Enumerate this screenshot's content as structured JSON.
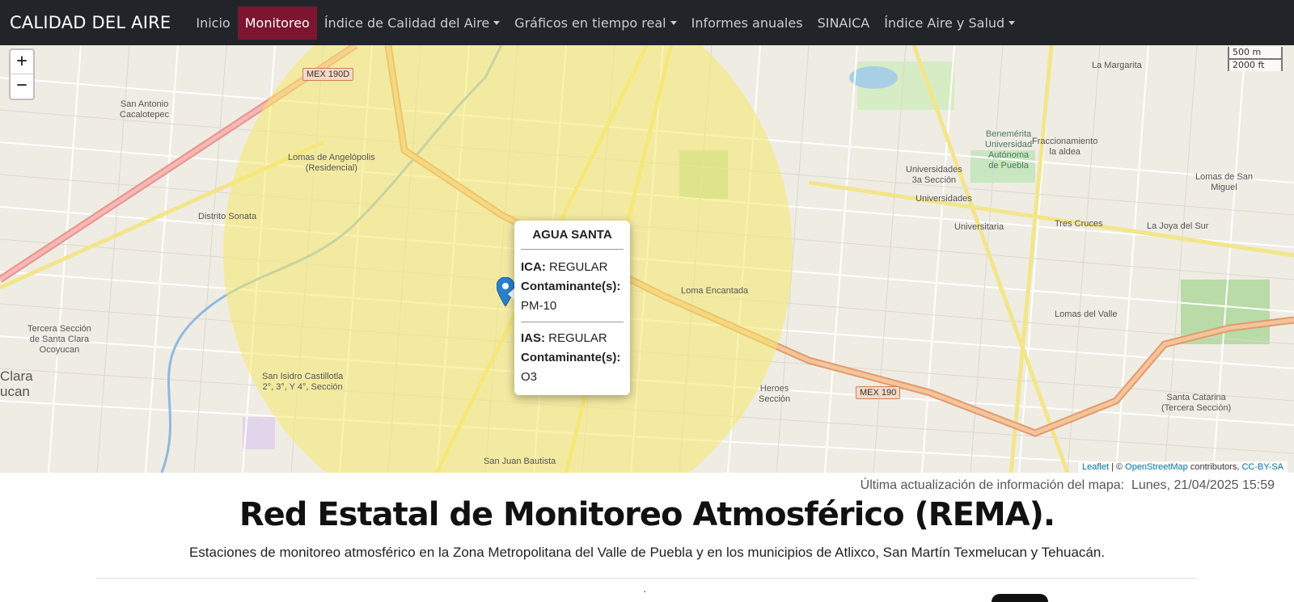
{
  "brand": "CALIDAD DEL AIRE",
  "nav": {
    "items": [
      {
        "label": "Inicio",
        "active": false,
        "dropdown": false
      },
      {
        "label": "Monitoreo",
        "active": true,
        "dropdown": false
      },
      {
        "label": "Índice de Calidad del Aire",
        "active": false,
        "dropdown": true
      },
      {
        "label": "Gráficos en tiempo real",
        "active": false,
        "dropdown": true
      },
      {
        "label": "Informes anuales",
        "active": false,
        "dropdown": false
      },
      {
        "label": "SINAICA",
        "active": false,
        "dropdown": false
      },
      {
        "label": "Índice Aire y Salud",
        "active": false,
        "dropdown": true
      }
    ]
  },
  "map": {
    "zoom_in": "+",
    "zoom_out": "−",
    "scale": {
      "metric": "500 m",
      "imperial": "2000 ft"
    },
    "labels": {
      "san_antonio": "San Antonio\nCacalotepec",
      "lomas_angelopolis": "Lomas de Angelópolis\n(Residencial)",
      "distrito_sonata": "Distrito Sonata",
      "tercera_seccion": "Tercera Sección\nde Santa Clara\nOcoyucan",
      "clara": "Clara\nucan",
      "san_isidro": "San Isidro Castillotla\n2°, 3°, Y 4°, Sección",
      "loma_encantada": "Loma Encantada",
      "universidades_3a": "Universidades\n3a Sección",
      "universidades": "Universidades",
      "universitaria": "Universitaria",
      "tres_cruces": "Tres Cruces",
      "la_joya": "La Joya del Sur",
      "lomas_del_valle": "Lomas del Valle",
      "santa_catarina": "Santa Catarina\n(Tercera Sección)",
      "lomas_san_miguel": "Lomas de San\nMiguel",
      "la_margarita": "La Margarita",
      "buap": "Benemérita\nUniversidad\nAutónoma\nde Puebla",
      "fraccionamiento": "Fraccionamiento\nla aldea",
      "heroes": "Heroes\nSección",
      "san_juan": "San Juan Bautista"
    },
    "shields": {
      "mex190d": "MEX 190D",
      "mex190": "MEX 190"
    },
    "marker_color": "#2a81cb",
    "circle_color": "#f5e96b",
    "popup": {
      "station": "AGUA SANTA",
      "ica_label": "ICA:",
      "ica_value": "REGULAR",
      "ica_pollutant_label": "Contaminante(s):",
      "ica_pollutant": "PM-10",
      "ias_label": "IAS:",
      "ias_value": "REGULAR",
      "ias_pollutant_label": "Contaminante(s):",
      "ias_pollutant": "O3"
    },
    "attribution": {
      "leaflet": "Leaflet",
      "sep": " | © ",
      "osm": "OpenStreetMap",
      "contrib": " contributors, ",
      "license": "CC-BY-SA"
    }
  },
  "updated": {
    "label": "Última actualización de información del mapa:",
    "value": "Lunes, 21/04/2025 15:59"
  },
  "page": {
    "title": "Red Estatal de Monitoreo Atmosférico (REMA).",
    "subtitle": "Estaciones de monitoreo atmosférico en la Zona Metropolitana del Valle de Puebla y en los municipios de Atlixco, San Martín Texmelucan y Tehuacán."
  }
}
